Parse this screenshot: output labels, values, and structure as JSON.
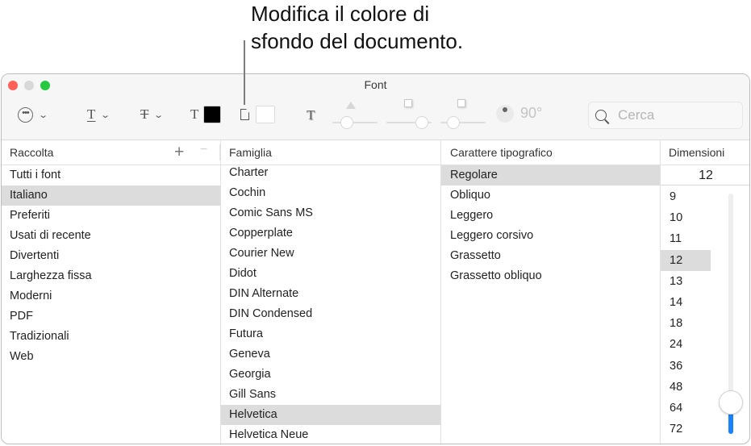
{
  "callout": {
    "line1": "Modifica il colore di",
    "line2": "sfondo del documento."
  },
  "window": {
    "title": "Font"
  },
  "toolbar": {
    "actions_icon": "ellipsis-circle-icon",
    "underline_icon": "underline-T-icon",
    "strikethrough_icon": "strikethrough-T-icon",
    "text_color_icon": "text-color-T-icon",
    "text_color": "#000000",
    "document_color_icon": "document-icon",
    "document_color": "#ffffff",
    "shadow_icon": "text-shadow-T-icon",
    "shadow_opacity": 0.25,
    "shadow_blur": 0.9,
    "shadow_offset": 0.2,
    "shadow_angle": "90°",
    "search_placeholder": "Cerca",
    "search_value": "",
    "glyphs": {
      "T": "T",
      "more": "•••",
      "chevron": "⌄"
    }
  },
  "columns": {
    "raccolta": {
      "header": "Raccolta",
      "add_label": "+",
      "remove_label": "−",
      "items": [
        "Tutti i font",
        "Italiano",
        "Preferiti",
        "Usati di recente",
        "Divertenti",
        "Larghezza fissa",
        "Moderni",
        "PDF",
        "Tradizionali",
        "Web"
      ],
      "selected": "Italiano"
    },
    "famiglia": {
      "header": "Famiglia",
      "items": [
        "Charter",
        "Cochin",
        "Comic Sans MS",
        "Copperplate",
        "Courier New",
        "Didot",
        "DIN Alternate",
        "DIN Condensed",
        "Futura",
        "Geneva",
        "Georgia",
        "Gill Sans",
        "Helvetica",
        "Helvetica Neue"
      ],
      "selected": "Helvetica"
    },
    "carattere": {
      "header": "Carattere tipografico",
      "items": [
        "Regolare",
        "Obliquo",
        "Leggero",
        "Leggero corsivo",
        "Grassetto",
        "Grassetto obliquo"
      ],
      "selected": "Regolare"
    },
    "dimensioni": {
      "header": "Dimensioni",
      "value": "12",
      "items": [
        "9",
        "10",
        "11",
        "12",
        "13",
        "14",
        "18",
        "24",
        "36",
        "48",
        "64",
        "72"
      ],
      "selected": "12",
      "slider_fraction": 0.13
    }
  }
}
